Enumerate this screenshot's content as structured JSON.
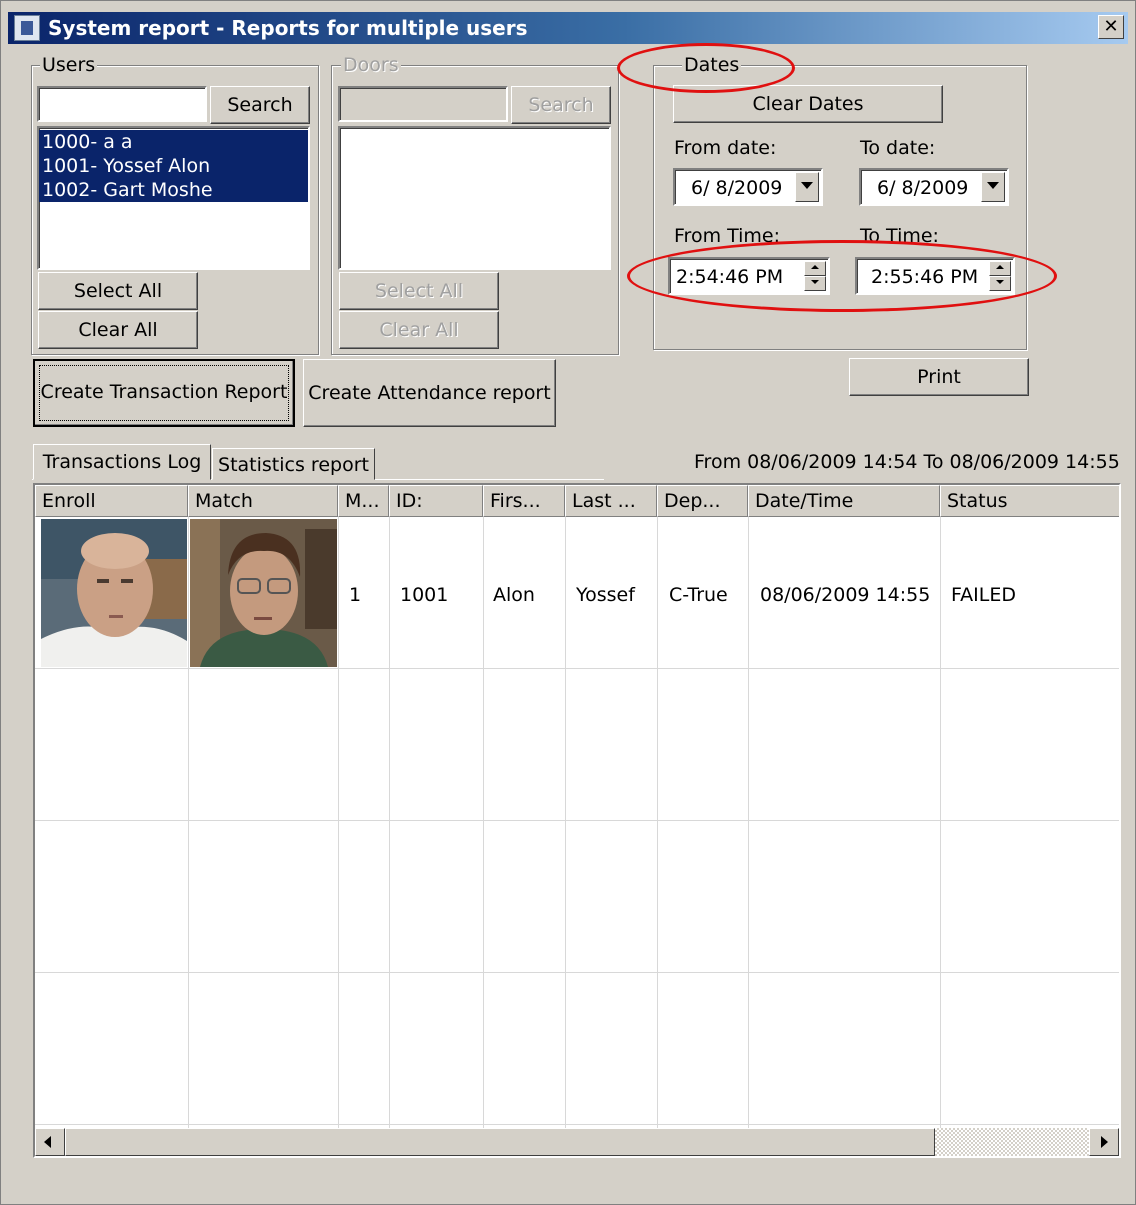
{
  "window": {
    "title": "System report - Reports for multiple users",
    "close_glyph": "✕"
  },
  "users": {
    "legend": "Users",
    "search_value": "",
    "search_label": "Search",
    "items": [
      "1000- a a",
      "1001- Yossef Alon",
      "1002- Gart Moshe"
    ],
    "select_all": "Select All",
    "clear_all": "Clear All"
  },
  "doors": {
    "legend": "Doors",
    "search_label": "Search",
    "select_all": "Select All",
    "clear_all": "Clear All"
  },
  "dates": {
    "legend": "Dates",
    "clear_dates": "Clear Dates",
    "from_date_label": "From date:",
    "to_date_label": "To date:",
    "from_date": "6/ 8/2009",
    "to_date": "6/ 8/2009",
    "from_time_label": "From Time:",
    "to_time_label": "To Time:",
    "from_time": "2:54:46 PM",
    "to_time": "2:55:46 PM"
  },
  "actions": {
    "create_transaction": "Create Transaction Report",
    "create_attendance": "Create Attendance report",
    "print": "Print"
  },
  "tabs": [
    "Transactions Log",
    "Statistics report"
  ],
  "range_text": "From 08/06/2009 14:54 To 08/06/2009 14:55",
  "table": {
    "columns": [
      "Enroll",
      "Match",
      "M...",
      "ID:",
      "Firs...",
      "Last ...",
      "Dep...",
      "Date/Time",
      "Status"
    ],
    "rows": [
      {
        "m": "1",
        "id": "1001",
        "first": "Alon",
        "last": "Yossef",
        "dep": "C-True",
        "datetime": "08/06/2009 14:55",
        "status": "FAILED"
      }
    ]
  },
  "colors": {
    "title_start": "#0a246a",
    "title_end": "#a6caf0",
    "selection": "#0a246a",
    "annotation": "#e01010",
    "face": "#d4d0c8"
  }
}
